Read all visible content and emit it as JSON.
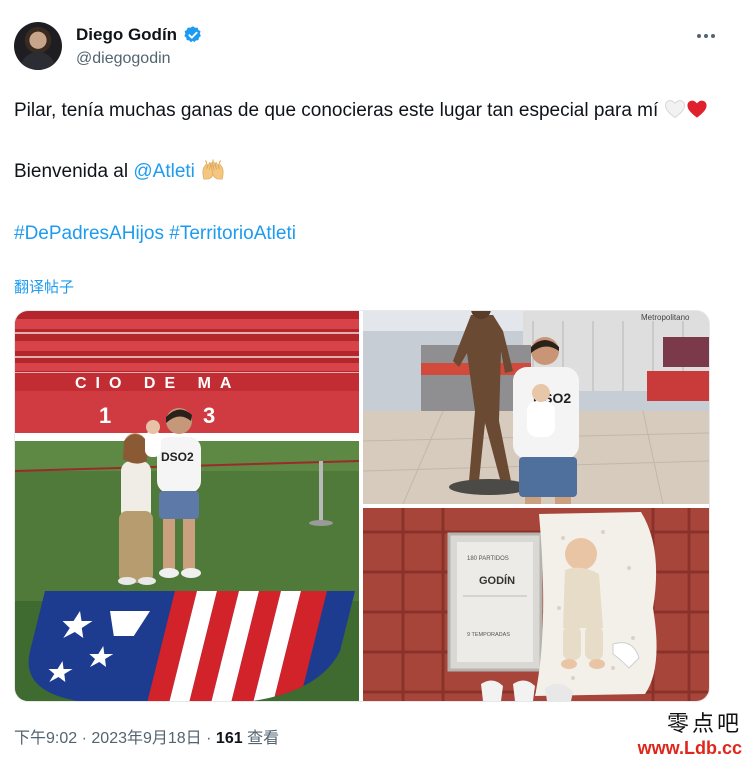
{
  "tweet": {
    "author_name": "Diego Godín",
    "handle": "@diegogodin",
    "text_line1": "Pilar, tenía muchas ganas de que conocieras este lugar tan especial para mí",
    "text_line2_prefix": "Bienvenida al ",
    "mention": "@Atleti",
    "hashtag1": "#DePadresAHijos",
    "hashtag2": "#TerritorioAtleti",
    "translate_label": "翻译帖子",
    "time": "下午9:02",
    "date": "2023年9月18日",
    "views_count": "161",
    "views_label": "查看",
    "separator": "·"
  },
  "media": {
    "stand_letters": "CIO DE MA",
    "shirt_text": "DSO2",
    "plaque_line1": "180 PARTIDOS",
    "plaque_name": "GODÍN",
    "plaque_line3": "9 TEMPORADAS",
    "stadium_sign": "Metropolitano"
  },
  "watermark": {
    "chinese": "零点吧",
    "url": "www.Ldb.cc"
  },
  "icons": {
    "verified": "verified-badge-icon",
    "more": "more-dots-icon",
    "white_heart": "white-heart-icon",
    "red_heart": "red-heart-icon",
    "clap": "raising-hands-icon"
  },
  "colors": {
    "link": "#1d9bf0",
    "secondary_text": "#536471",
    "atleti_red": "#d2232a",
    "atleti_blue": "#1d3c8f"
  }
}
